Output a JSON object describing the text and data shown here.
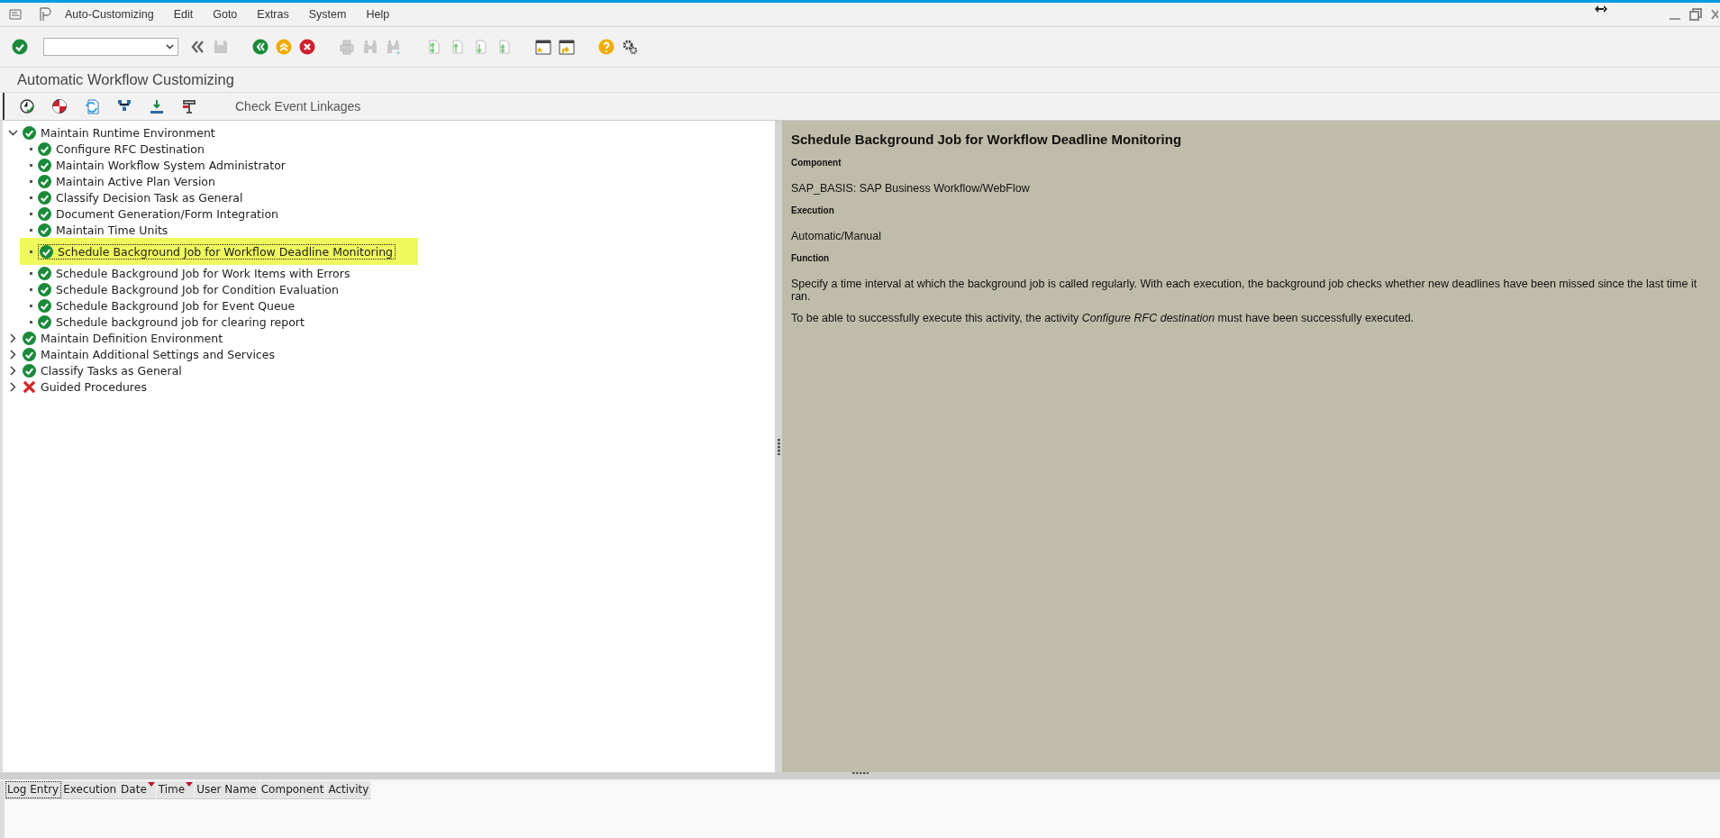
{
  "menu": [
    "Auto-Customizing",
    "Edit",
    "Goto",
    "Extras",
    "System",
    "Help"
  ],
  "title": "Automatic Workflow Customizing",
  "app_toolbar": {
    "button": "Check Event Linkages"
  },
  "tree": [
    {
      "label": "Maintain Runtime Environment",
      "done": true,
      "expanded": true,
      "selected": false,
      "children": [
        {
          "label": "Configure RFC Destination",
          "done": true,
          "selected": false
        },
        {
          "label": "Maintain Workflow System Administrator",
          "done": true,
          "selected": false
        },
        {
          "label": "Maintain Active Plan Version",
          "done": true,
          "selected": false
        },
        {
          "label": "Classify Decision Task as General",
          "done": true,
          "selected": false
        },
        {
          "label": "Document Generation/Form Integration",
          "done": true,
          "selected": false
        },
        {
          "label": "Maintain Time Units",
          "done": true,
          "selected": false
        },
        {
          "label": "Schedule Background Job for Workflow Deadline Monitoring",
          "done": true,
          "selected": true
        },
        {
          "label": "Schedule Background Job for Work Items with Errors",
          "done": true,
          "selected": false
        },
        {
          "label": "Schedule Background Job for Condition Evaluation",
          "done": true,
          "selected": false
        },
        {
          "label": "Schedule Background Job for Event Queue",
          "done": true,
          "selected": false
        },
        {
          "label": "Schedule background job for clearing report",
          "done": true,
          "selected": false
        }
      ]
    },
    {
      "label": "Maintain Definition Environment",
      "done": true,
      "expanded": false,
      "selected": false
    },
    {
      "label": "Maintain Additional Settings and Services",
      "done": true,
      "expanded": false,
      "selected": false
    },
    {
      "label": "Classify Tasks as General",
      "done": true,
      "expanded": false,
      "selected": false
    },
    {
      "label": "Guided Procedures",
      "done": false,
      "expanded": false,
      "selected": false
    }
  ],
  "detail": {
    "title": "Schedule Background Job for Workflow Deadline Monitoring",
    "sections": [
      {
        "heading": "Component",
        "paragraphs": [
          "SAP_BASIS: SAP Business Workflow/WebFlow"
        ]
      },
      {
        "heading": "Execution",
        "paragraphs": [
          "Automatic/Manual"
        ]
      },
      {
        "heading": "Function",
        "paragraphs": [
          "Specify a time interval at which the background job is called regularly. With each execution, the background job checks whether new deadlines have been missed since the last time it ran.",
          "To be able to successfully execute this activity, the activity *Configure RFC destination* must have been successfully executed."
        ]
      }
    ]
  },
  "log_table": {
    "columns": [
      {
        "label": "Log Entry",
        "sorted": false,
        "focused": true
      },
      {
        "label": "Execution",
        "sorted": false,
        "focused": false
      },
      {
        "label": "Date",
        "sorted": true,
        "focused": false
      },
      {
        "label": "Time",
        "sorted": true,
        "focused": false
      },
      {
        "label": "User Name",
        "sorted": false,
        "focused": false
      },
      {
        "label": "Component",
        "sorted": false,
        "focused": false
      },
      {
        "label": "Activity",
        "sorted": false,
        "focused": false
      }
    ]
  }
}
